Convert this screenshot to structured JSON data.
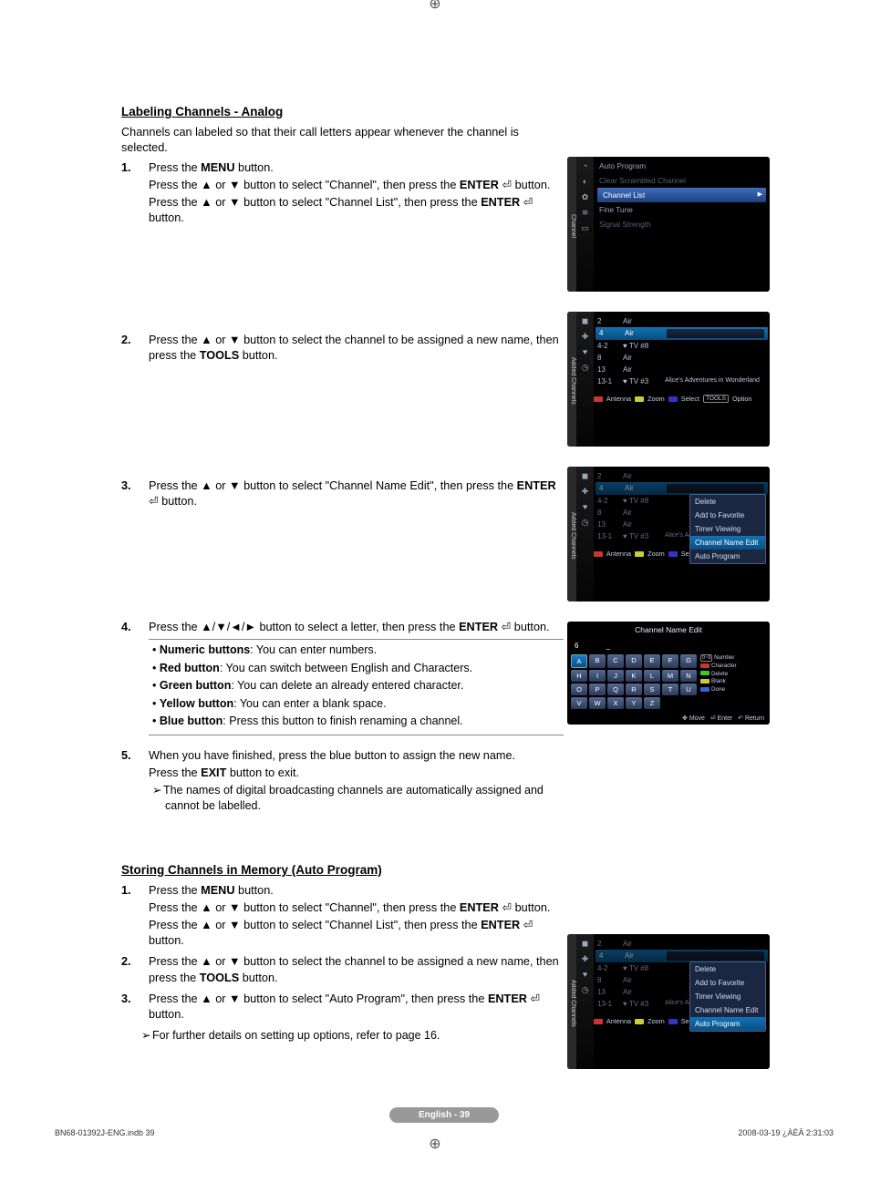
{
  "sections": {
    "labeling": {
      "heading": "Labeling Channels - Analog",
      "intro": "Channels can labeled so that their call letters appear whenever the channel is selected.",
      "step1_a": "Press the MENU button.",
      "step1_b": "Press the ▲ or ▼ button to select \"Channel\", then press the ENTER ⏎ button.",
      "step1_c": "Press the ▲ or ▼ button to select \"Channel List\", then press the ENTER ⏎ button.",
      "step2": "Press the ▲ or ▼ button to select the channel to be assigned a new name, then press the TOOLS button.",
      "step3": "Press the ▲ or ▼ button to select \"Channel Name Edit\", then press the ENTER ⏎ button.",
      "step4_a": "Press the ▲/▼/◄/► button to select a letter, then press the ENTER ⏎ button.",
      "step4_bullets": {
        "b1": "Numeric buttons: You can enter numbers.",
        "b2": "Red button: You can switch between English and Characters.",
        "b3": "Green button: You can delete an already entered character.",
        "b4": "Yellow button: You can enter a blank space.",
        "b5": "Blue button: Press this button to finish renaming a channel."
      },
      "step5_a": "When you have finished, press the blue button to assign the new name.",
      "step5_b": "Press the EXIT button to exit.",
      "step5_note": "The names of digital broadcasting channels are automatically assigned and cannot be labelled."
    },
    "storing": {
      "heading": "Storing Channels in Memory (Auto Program)",
      "step1_a": "Press the MENU button.",
      "step1_b": "Press the ▲ or ▼ button to select \"Channel\", then press the ENTER ⏎ button.",
      "step1_c": "Press the ▲ or ▼ button to select \"Channel List\", then press the ENTER ⏎ button.",
      "step2": "Press the ▲ or ▼ button to select the channel to be assigned a new name, then press the TOOLS button.",
      "step3": "Press the ▲ or ▼ button to select \"Auto Program\", then press the ENTER ⏎ button.",
      "note": "For further details on setting up options, refer to page 16."
    }
  },
  "osd": {
    "menu1": {
      "side": "Channel",
      "items": [
        "Auto Program",
        "Clear Scrambled Channel",
        "Channel List",
        "Fine Tune",
        "Signal Strength"
      ],
      "highlight_index": 2
    },
    "chlist": {
      "side": "Added Channels",
      "rows": [
        {
          "num": "2",
          "src": "Air",
          "title": ""
        },
        {
          "num": "4",
          "src": "Air",
          "title": "",
          "sel": true,
          "prog": true
        },
        {
          "num": "4-2",
          "src": "♥ TV #8",
          "title": ""
        },
        {
          "num": "8",
          "src": "Air",
          "title": ""
        },
        {
          "num": "13",
          "src": "Air",
          "title": ""
        },
        {
          "num": "13-1",
          "src": "♥ TV #3",
          "title": "Alice's Adventures in Wonderland"
        }
      ],
      "foot": {
        "left": "Air",
        "antenna": "Antenna",
        "zoom": "Zoom",
        "select": "Select",
        "option": "Option",
        "tools": "TOOLS"
      }
    },
    "popup1": {
      "items": [
        "Delete",
        "Add to Favorite",
        "Timer Viewing",
        "Channel Name Edit",
        "Auto Program"
      ],
      "sel_index": 3
    },
    "kbd": {
      "title": "Channel Name Edit",
      "input_num": "6",
      "input_val": "_",
      "rows": [
        [
          "A",
          "B",
          "C",
          "D",
          "E",
          "F",
          "G"
        ],
        [
          "H",
          "I",
          "J",
          "K",
          "L",
          "M",
          "N"
        ],
        [
          "O",
          "P",
          "Q",
          "R",
          "S",
          "T",
          "U"
        ],
        [
          "V",
          "W",
          "X",
          "Y",
          "Z",
          "",
          ""
        ]
      ],
      "legend": {
        "num": "Number",
        "char": "Character",
        "del": "Delete",
        "blank": "Blank",
        "done": "Done"
      },
      "foot": {
        "move": "Move",
        "enter": "Enter",
        "return": "Return"
      }
    },
    "popup2": {
      "items": [
        "Delete",
        "Add to Favorite",
        "Timer Viewing",
        "Channel Name Edit",
        "Auto Program"
      ],
      "sel_index": 4
    }
  },
  "page_footer": {
    "pill": "English - 39",
    "left": "BN68-01392J-ENG.indb   39",
    "right": "2008-03-19   ¿ÀÈÄ 2:31:03"
  }
}
